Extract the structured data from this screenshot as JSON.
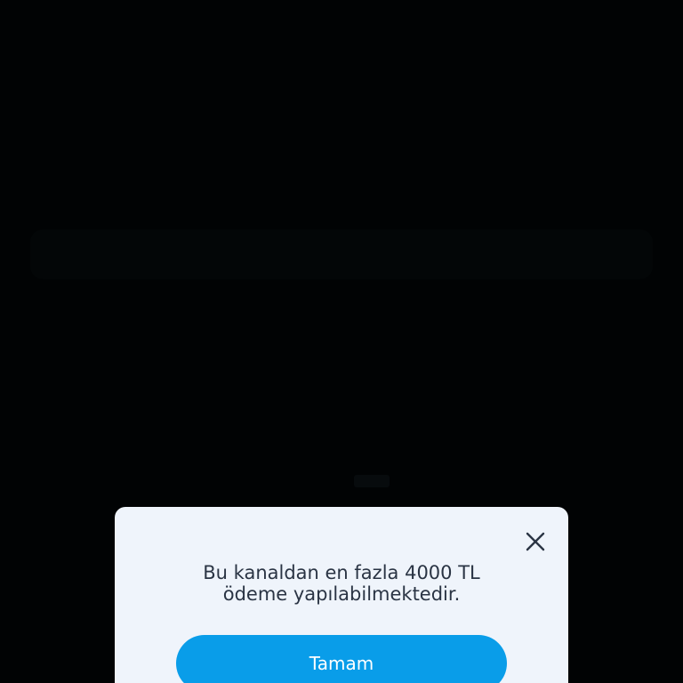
{
  "dialog": {
    "message_line1": "Bu kanaldan en fazla 4000 TL",
    "message_line2": "ödeme yapılabilmektedir.",
    "confirm_label": "Tamam",
    "close_icon": "close-icon"
  },
  "colors": {
    "backdrop": "#010304",
    "dialog_background": "#eff4fb",
    "text": "#2a3444",
    "button": "#099de9",
    "button_text": "#ffffff"
  }
}
